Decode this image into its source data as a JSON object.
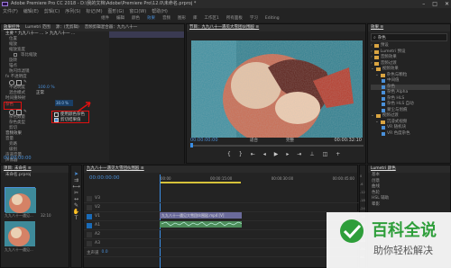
{
  "titlebar": {
    "title": "Adobe Premiere Pro CC 2018 - D:\\我的文档\\Adobe\\Premiere Pro\\12.0\\未命名.prproj *"
  },
  "menubar": {
    "items": [
      "文件(F)",
      "编辑(E)",
      "剪辑(C)",
      "序列(S)",
      "标记(M)",
      "图形(G)",
      "窗口(W)",
      "帮助(H)"
    ]
  },
  "workspace_tabs": [
    "组件",
    "编辑",
    "颜色",
    "效果",
    "音频",
    "图形",
    "库",
    "工作区1",
    "所有面板",
    "学习",
    "Editing"
  ],
  "effect_controls": {
    "tabs": [
      "效果控件",
      "Lumetri 范围",
      "源：(无剪辑)",
      "音频剪辑混合器：九九八十一"
    ],
    "header": "主要 * 九九八十一 ... > 九九八十一 ...",
    "rows": [
      {
        "label": "位置",
        "value": "",
        "indent": 1
      },
      {
        "label": "缩放",
        "value": "",
        "indent": 1
      },
      {
        "label": "缩放宽度",
        "value": "",
        "indent": 1
      },
      {
        "label": "等比缩放",
        "value": "",
        "indent": 2
      },
      {
        "label": "旋转",
        "value": "",
        "indent": 1
      },
      {
        "label": "锚点",
        "value": "",
        "indent": 1
      },
      {
        "label": "防闪烁滤镜",
        "value": "",
        "indent": 1
      },
      {
        "label": "fx 不透明度",
        "value": "",
        "indent": 0
      },
      {
        "label": "",
        "value": "",
        "indent": 1
      },
      {
        "label": "不透明度",
        "value": "100.0 %",
        "indent": 1
      },
      {
        "label": "混合模式",
        "value": "正常",
        "indent": 1
      },
      {
        "label": "时间重映射",
        "value": "",
        "indent": 0
      }
    ],
    "noise_section": {
      "label": "杂色",
      "amount_label": "杂色数量",
      "amount_value": "30.0 %",
      "type_label": "杂色类型",
      "type_option": "使用颜色杂色",
      "clip_label": "剪切",
      "clip_option": "剪切结果值"
    },
    "audio_rows": [
      "音频效果",
      "音量",
      "旁路",
      "级别",
      "声道音量",
      "声像器"
    ],
    "timecode": "00:00:00:00"
  },
  "program_monitor": {
    "tab": "节目：九九八十一遇见大雪团伙围殴 ≡",
    "timecode_left": "00:00:00:00",
    "fit": "适合",
    "quality": "完整",
    "timecode_right": "00:00:32:10"
  },
  "effects_panel": {
    "tab": "效果 ≡",
    "search_placeholder": "杂色",
    "items": [
      {
        "label": "预设",
        "type": "folder",
        "indent": 0
      },
      {
        "label": "Lumetri 预设",
        "type": "folder",
        "indent": 0
      },
      {
        "label": "音频效果",
        "type": "folder",
        "indent": 0
      },
      {
        "label": "音频过渡",
        "type": "folder",
        "indent": 0
      },
      {
        "label": "视频效果",
        "type": "folder",
        "indent": 0
      },
      {
        "label": "杂色与颗粒",
        "type": "folder",
        "indent": 1
      },
      {
        "label": "中间值",
        "type": "fx",
        "indent": 2
      },
      {
        "label": "杂色",
        "type": "fx",
        "indent": 2
      },
      {
        "label": "杂色 Alpha",
        "type": "fx",
        "indent": 2
      },
      {
        "label": "杂色 HLS",
        "type": "fx",
        "indent": 2
      },
      {
        "label": "杂色 HLS 自动",
        "type": "fx",
        "indent": 2
      },
      {
        "label": "蒙尘与划痕",
        "type": "fx",
        "indent": 2
      },
      {
        "label": "视频过渡",
        "type": "folder",
        "indent": 0
      },
      {
        "label": "沉浸式视频",
        "type": "folder",
        "indent": 1
      },
      {
        "label": "VR 随机块",
        "type": "fx",
        "indent": 2
      },
      {
        "label": "VR 色度杂色",
        "type": "fx",
        "indent": 2
      }
    ],
    "lower_items": [
      "Lumetri 颜色",
      "基本",
      "创意",
      "曲线",
      "色轮",
      "HSL 辅助",
      "晕影"
    ]
  },
  "project_panel": {
    "tab": "项目: 未命名 ≡",
    "project_name": "未命名.prproj",
    "clips": [
      {
        "name": "九九八十一遇见...",
        "duration": "32:10"
      },
      {
        "name": "九九八十一遇见...",
        "duration": ""
      }
    ]
  },
  "timeline": {
    "tab": "九九八十一遇见大雪团伙围殴 ≡",
    "timecode": "00:00:00:00",
    "ruler": [
      "00:00",
      "00:00:15:00",
      "00:00:30:00",
      "00:00:45:00"
    ],
    "video_tracks": [
      "V3",
      "V2",
      "V1"
    ],
    "audio_tracks": [
      "A1",
      "A2",
      "A3"
    ],
    "master_label": "主声道",
    "master_value": "0.0",
    "video_clip": "九九八十一遇见大雪团伙围殴.mp4 [V]",
    "audio_clip": ""
  },
  "audio_meter": {
    "labels": [
      "0",
      "-6",
      "-12",
      "-18",
      "-24",
      "-30",
      "-36",
      "-42",
      "-48",
      "-54",
      "dB"
    ]
  },
  "watermark": {
    "title": "百科全说",
    "subtitle": "助你轻松解决"
  },
  "colors": {
    "accent_blue": "#4a90d9",
    "red_box": "#e01010",
    "playhead": "#3a8ee6",
    "watermark_green": "#2e9e3a"
  }
}
